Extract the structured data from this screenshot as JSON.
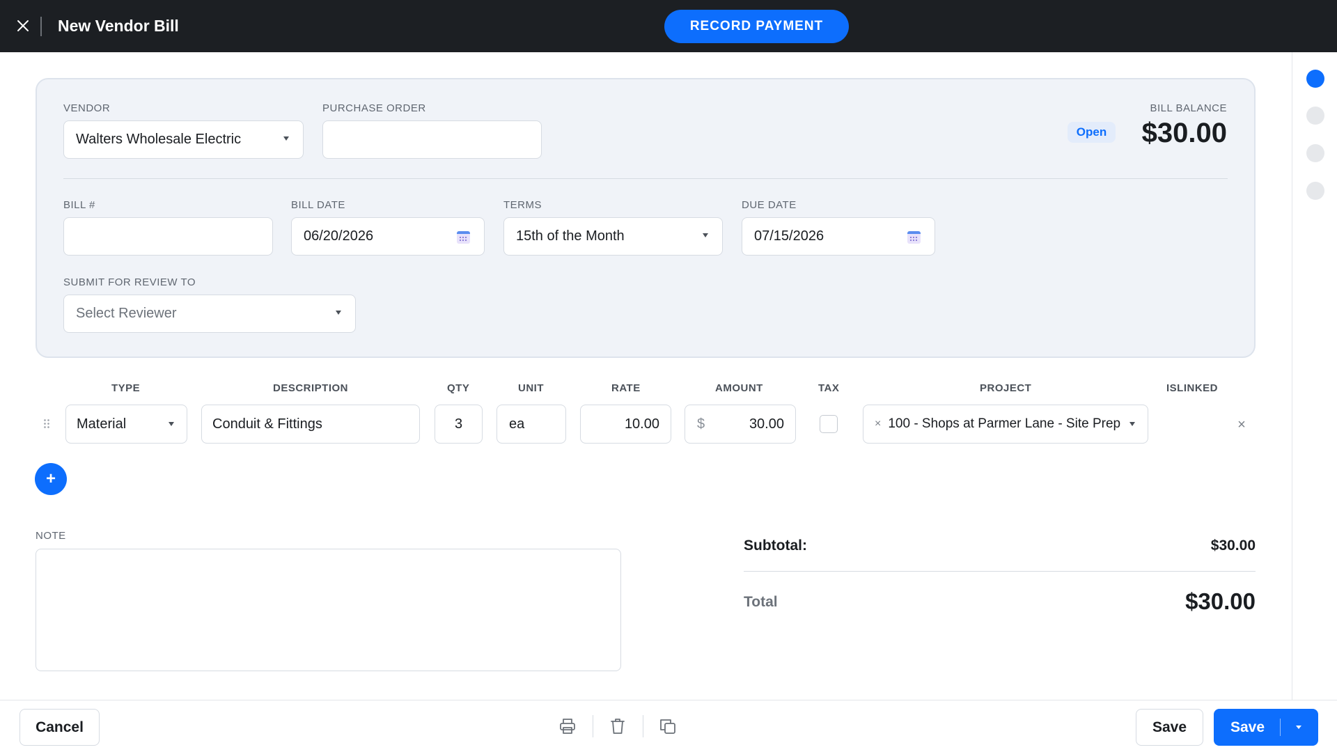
{
  "header": {
    "title": "New Vendor Bill",
    "record_payment_label": "RECORD PAYMENT"
  },
  "bill": {
    "vendor_label": "VENDOR",
    "vendor_value": "Walters Wholesale Electric",
    "po_label": "PURCHASE ORDER",
    "po_value": "",
    "balance_label": "BILL BALANCE",
    "status": "Open",
    "balance": "$30.00",
    "bill_no_label": "BILL #",
    "bill_no_value": "",
    "bill_date_label": "BILL DATE",
    "bill_date_value": "06/20/2026",
    "terms_label": "TERMS",
    "terms_value": "15th of the Month",
    "due_date_label": "DUE DATE",
    "due_date_value": "07/15/2026",
    "review_label": "SUBMIT FOR REVIEW TO",
    "review_placeholder": "Select Reviewer"
  },
  "lines": {
    "headers": {
      "type": "TYPE",
      "description": "DESCRIPTION",
      "qty": "QTY",
      "unit": "UNIT",
      "rate": "RATE",
      "amount": "AMOUNT",
      "tax": "TAX",
      "project": "PROJECT",
      "islinked": "ISLINKED"
    },
    "rows": [
      {
        "type": "Material",
        "description": "Conduit & Fittings",
        "qty": "3",
        "unit": "ea",
        "rate": "10.00",
        "currency": "$",
        "amount": "30.00",
        "tax": false,
        "project": "100 - Shops at Parmer Lane - Site Prep"
      }
    ]
  },
  "note": {
    "label": "NOTE",
    "value": ""
  },
  "totals": {
    "subtotal_label": "Subtotal:",
    "subtotal": "$30.00",
    "total_label": "Total",
    "total": "$30.00"
  },
  "footer": {
    "cancel_label": "Cancel",
    "save_label": "Save",
    "save_primary_label": "Save"
  },
  "steps": {
    "count": 4,
    "active": 0
  },
  "colors": {
    "accent": "#0d6efd",
    "header_bg": "#1c1f23",
    "panel_bg": "#f0f3f8"
  }
}
